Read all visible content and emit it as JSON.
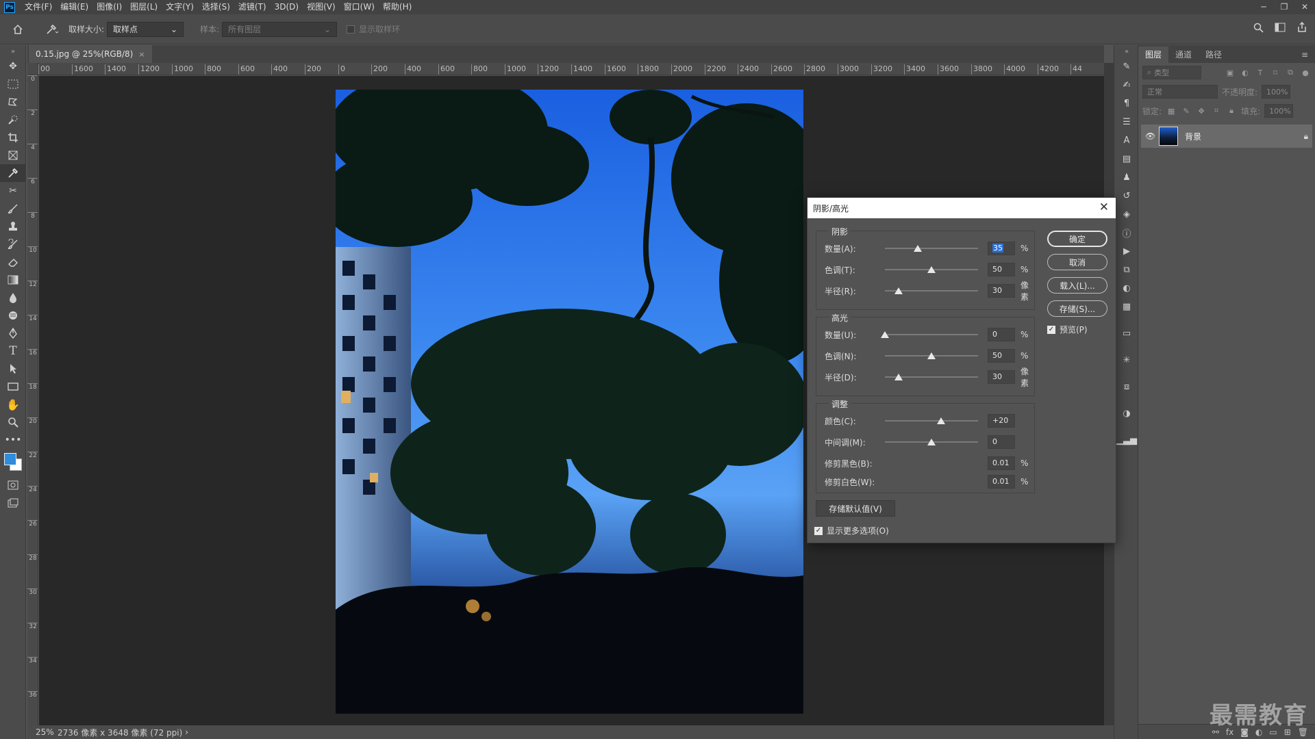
{
  "app": {
    "logo": "Ps",
    "menus": [
      "文件(F)",
      "编辑(E)",
      "图像(I)",
      "图层(L)",
      "文字(Y)",
      "选择(S)",
      "滤镜(T)",
      "3D(D)",
      "视图(V)",
      "窗口(W)",
      "帮助(H)"
    ]
  },
  "options": {
    "sample_size_label": "取样大小:",
    "sample_size_value": "取样点",
    "sample_label": "样本:",
    "sample_value": "所有图层",
    "show_ring_label": "显示取样环"
  },
  "document": {
    "tab_title": "0.15.jpg @ 25%(RGB/8)",
    "zoom": "25%",
    "info": "2736 像素 x 3648 像素 (72 ppi)",
    "ruler_top": [
      "00",
      "1600",
      "1400",
      "1200",
      "1000",
      "800",
      "600",
      "400",
      "200",
      "0",
      "200",
      "400",
      "600",
      "800",
      "1000",
      "1200",
      "1400",
      "1600",
      "1800",
      "2000",
      "2200",
      "2400",
      "2600",
      "2800",
      "3000",
      "3200",
      "3400",
      "3600",
      "3800",
      "4000",
      "4200",
      "44"
    ],
    "ruler_left": [
      "0",
      "2",
      "4",
      "6",
      "8",
      "10",
      "12",
      "14",
      "16",
      "18",
      "20",
      "22",
      "24",
      "26",
      "28",
      "30",
      "32",
      "34",
      "36"
    ]
  },
  "layers_panel": {
    "tabs": [
      "图层",
      "通道",
      "路径"
    ],
    "filter_placeholder": "类型",
    "blend_mode": "正常",
    "opacity_label": "不透明度:",
    "opacity_value": "100%",
    "lock_label": "锁定:",
    "fill_label": "填充:",
    "fill_value": "100%",
    "layers": [
      {
        "name": "背景",
        "visible": true,
        "locked": true
      }
    ]
  },
  "dialog": {
    "title": "阴影/高光",
    "shadows": {
      "title": "阴影",
      "amount_label": "数量(A):",
      "amount_value": "35",
      "amount_unit": "%",
      "amount_pct": 35,
      "tone_label": "色调(T):",
      "tone_value": "50",
      "tone_unit": "%",
      "tone_pct": 50,
      "radius_label": "半径(R):",
      "radius_value": "30",
      "radius_unit": "像素",
      "radius_pct": 15
    },
    "highlights": {
      "title": "高光",
      "amount_label": "数量(U):",
      "amount_value": "0",
      "amount_unit": "%",
      "amount_pct": 0,
      "tone_label": "色调(N):",
      "tone_value": "50",
      "tone_unit": "%",
      "tone_pct": 50,
      "radius_label": "半径(D):",
      "radius_value": "30",
      "radius_unit": "像素",
      "radius_pct": 15
    },
    "adjustments": {
      "title": "调整",
      "color_label": "颜色(C):",
      "color_value": "+20",
      "color_pct": 60,
      "midtone_label": "中间调(M):",
      "midtone_value": "0",
      "midtone_pct": 50,
      "clip_black_label": "修剪黑色(B):",
      "clip_black_value": "0.01",
      "clip_black_unit": "%",
      "clip_white_label": "修剪白色(W):",
      "clip_white_value": "0.01",
      "clip_white_unit": "%"
    },
    "buttons": {
      "ok": "确定",
      "cancel": "取消",
      "load": "载入(L)...",
      "save": "存储(S)...",
      "preview": "预览(P)",
      "save_default": "存储默认值(V)",
      "more_options": "显示更多选项(O)"
    }
  },
  "watermark": "最需教育",
  "colors": {
    "foreground": "#2e8ddc",
    "background": "#ffffff",
    "selection": "#2d6fd6"
  }
}
